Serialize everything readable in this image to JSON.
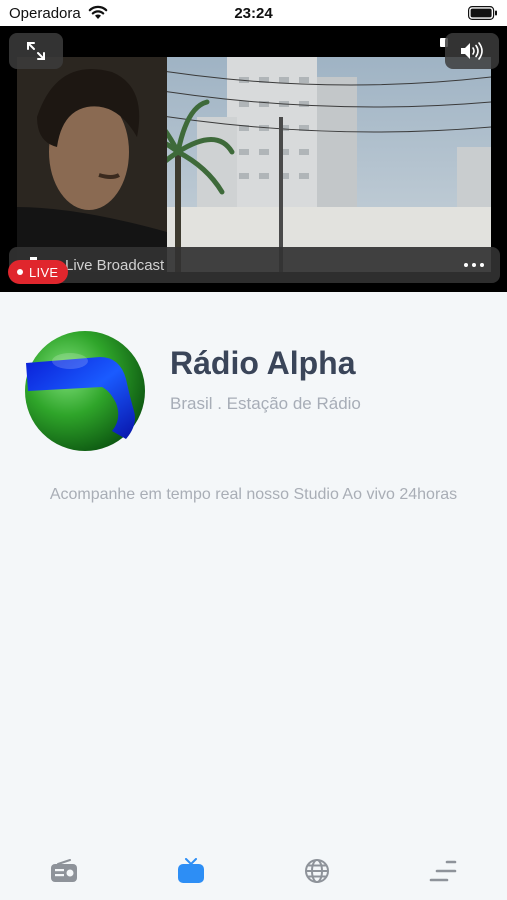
{
  "status_bar": {
    "carrier": "Operadora",
    "time": "23:24"
  },
  "player": {
    "title": "Live Broadcast",
    "live_label": "LIVE",
    "colors": {
      "live": "#e0262d"
    }
  },
  "station": {
    "name": "Rádio Alpha",
    "subtitle": "Brasil . Estação de Rádio",
    "description": "Acompanhe em tempo real nosso Studio Ao vivo 24horas"
  },
  "tab_bar": {
    "items": [
      {
        "icon": "radio-icon",
        "selected": false
      },
      {
        "icon": "tv-icon",
        "selected": true
      },
      {
        "icon": "globe-icon",
        "selected": false
      },
      {
        "icon": "menu-icon",
        "selected": false
      }
    ],
    "colors": {
      "active": "#2d8ef5",
      "inactive": "#8e939a"
    }
  }
}
